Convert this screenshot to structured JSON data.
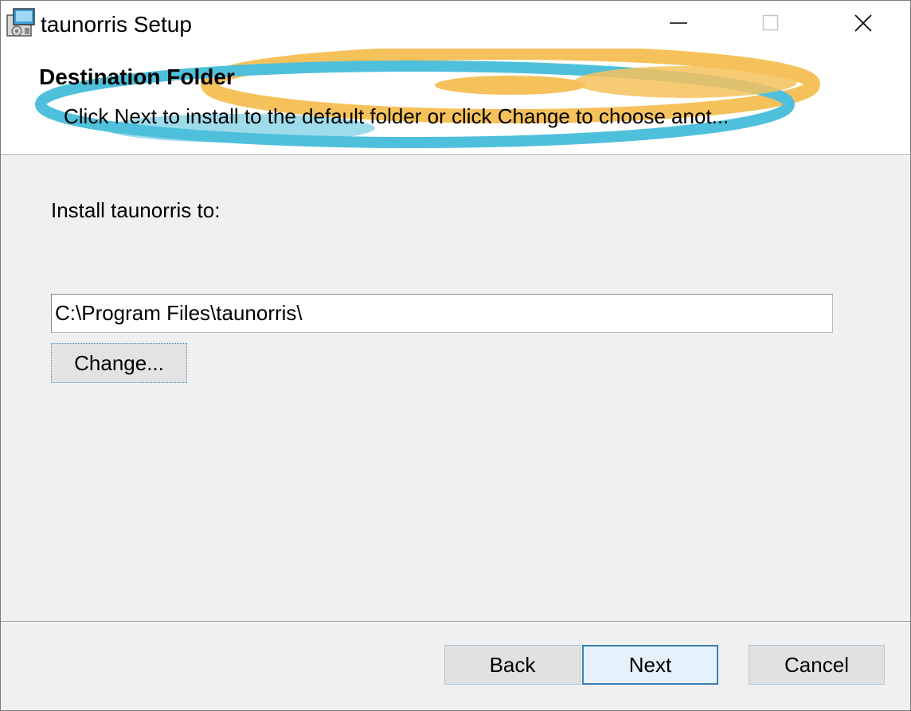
{
  "window": {
    "title": "taunorris Setup"
  },
  "titlebar": {
    "icons": {
      "app": "installer-icon",
      "minimize": "minimize-icon",
      "maximize": "maximize-icon",
      "close": "close-icon"
    }
  },
  "banner": {
    "title": "Destination Folder",
    "description": "Click Next to install to the default folder or click Change to choose anot..."
  },
  "main": {
    "install_label": "Install taunorris to:",
    "path_value": "C:\\Program Files\\taunorris\\",
    "change_label": "Change..."
  },
  "footer": {
    "back_label": "Back",
    "next_label": "Next",
    "cancel_label": "Cancel"
  },
  "colors": {
    "swoosh_orange": "#f4b73f",
    "swoosh_blue": "#2fb5d6",
    "dialog_bg": "#f0f0f0",
    "default_button_border": "#3c7fb1"
  }
}
